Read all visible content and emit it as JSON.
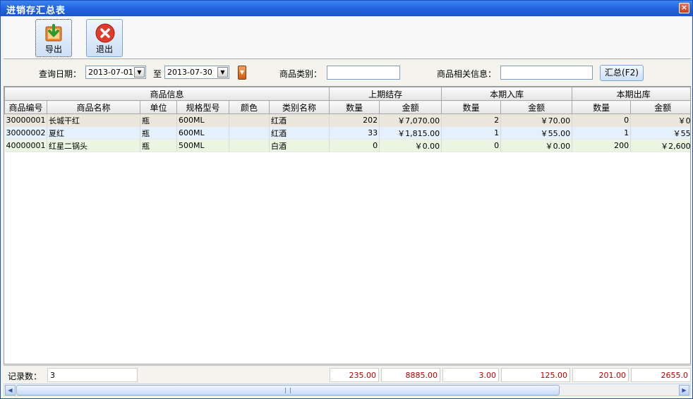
{
  "window": {
    "title": "进销存汇总表",
    "close_glyph": "×"
  },
  "toolbar": {
    "export_label": "导出",
    "exit_label": "退出",
    "export_icon": "export-icon",
    "exit_icon": "exit-icon"
  },
  "filter": {
    "date_label": "查询日期：",
    "date_from": "2013-07-01",
    "to_label": "至",
    "date_to": "2013-07-30",
    "category_label": "商品类别：",
    "category_value": "",
    "info_label": "商品相关信息：",
    "info_value": "",
    "sum_button": "汇总(F2)",
    "dropdown_glyph": "▼"
  },
  "grid": {
    "groups": [
      "商品信息",
      "上期结存",
      "本期入库",
      "本期出库"
    ],
    "columns": [
      "商品编号",
      "商品名称",
      "单位",
      "规格型号",
      "颜色",
      "类别名称",
      "数量",
      "金额",
      "数量",
      "金额",
      "数量",
      "金额"
    ],
    "rows": [
      [
        "30000001",
        "长城干红",
        "瓶",
        "600ML",
        "",
        "红酒",
        "202",
        "￥7,070.00",
        "2",
        "￥70.00",
        "0",
        "￥0."
      ],
      [
        "30000002",
        "夏红",
        "瓶",
        "600ML",
        "",
        "红酒",
        "33",
        "￥1,815.00",
        "1",
        "￥55.00",
        "1",
        "￥55."
      ],
      [
        "40000001",
        "红星二锅头",
        "瓶",
        "500ML",
        "",
        "白酒",
        "0",
        "￥0.00",
        "0",
        "￥0.00",
        "200",
        "￥2,600."
      ]
    ]
  },
  "footer": {
    "record_label": "记录数：",
    "record_count": "3",
    "totals": [
      "235.00",
      "8885.00",
      "3.00",
      "125.00",
      "201.00",
      "2655.0"
    ]
  },
  "colors": {
    "title_bar": "#2466e0",
    "totals_text": "#c00000"
  }
}
